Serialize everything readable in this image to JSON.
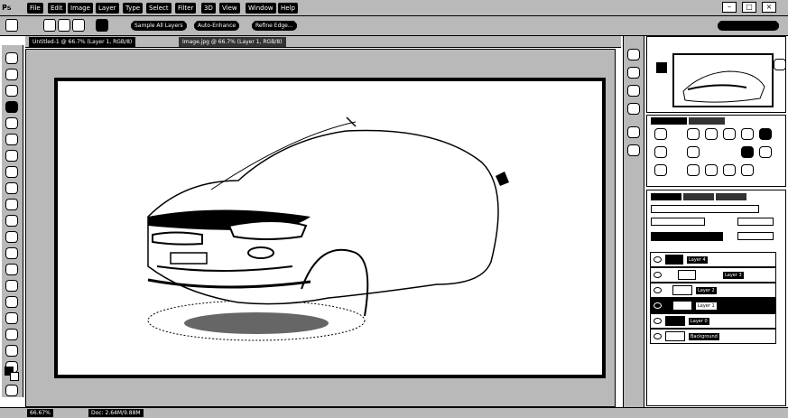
{
  "app": {
    "logo": "Ps"
  },
  "menu": [
    "File",
    "Edit",
    "Image",
    "Layer",
    "Type",
    "Select",
    "Filter",
    "3D",
    "View",
    "Window",
    "Help"
  ],
  "window_controls": [
    "–",
    "□",
    "×"
  ],
  "options_bar": {
    "labels": [
      "Sample All Layers",
      "Auto-Enhance",
      "Refine Edge..."
    ]
  },
  "doc_tabs": [
    "Untitled-1 @ 66.7% (Layer 1, RGB/8)",
    "Image.jpg @ 66.7% (Layer 1, RGB/8)"
  ],
  "layers": [
    {
      "name": "Layer 4"
    },
    {
      "name": "Layer 3"
    },
    {
      "name": "Layer 2"
    },
    {
      "name": "Layer 1"
    },
    {
      "name": "Layer 0"
    },
    {
      "name": "Background"
    }
  ],
  "status": {
    "zoom": "66.67%",
    "doc": "Doc: 2.64M/9.88M"
  }
}
